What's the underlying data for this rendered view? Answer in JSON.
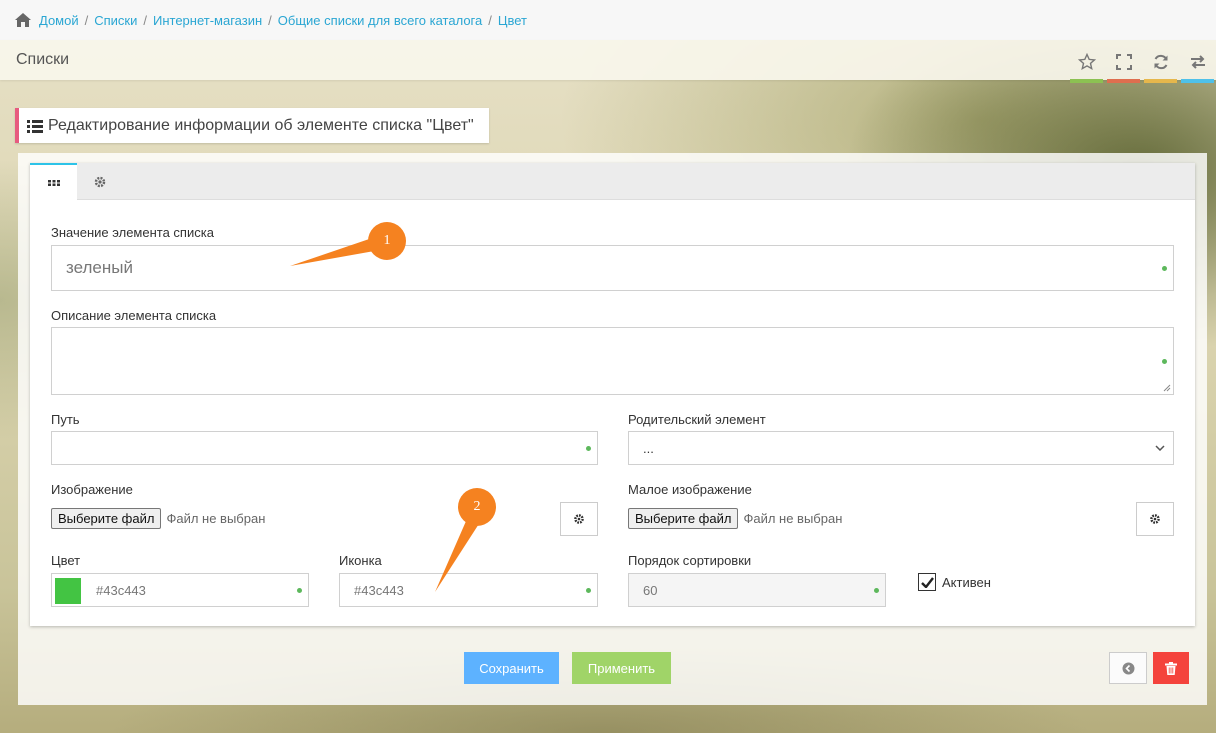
{
  "breadcrumbs": [
    "Домой",
    "Списки",
    "Интернет-магазин",
    "Общие списки для всего каталога",
    "Цвет"
  ],
  "page": {
    "title": "Списки"
  },
  "header_buttons": [
    "star-icon",
    "expand-icon",
    "refresh-icon",
    "exchange-icon"
  ],
  "section": {
    "caption": "Редактирование информации об элементе списка \"Цвет\""
  },
  "tabs": [
    "main-tab-icon",
    "settings-tab-icon"
  ],
  "form": {
    "value_label": "Значение элемента списка",
    "value": "зеленый",
    "description_label": "Описание элемента списка",
    "path_label": "Путь",
    "parent_label": "Родительский элемент",
    "parent_value": "...",
    "image_label": "Изображение",
    "small_image_label": "Малое изображение",
    "choose_file": "Выберите файл",
    "no_file": "Файл не выбран",
    "color_label": "Цвет",
    "color_value": "#43c443",
    "icon_label": "Иконка",
    "icon_value": "#43c443",
    "sort_label": "Порядок сортировки",
    "sort_value": "60",
    "active_label": "Активен",
    "active_checked": true
  },
  "buttons": {
    "save": "Сохранить",
    "apply": "Применить"
  },
  "annotations": [
    "1",
    "2"
  ],
  "colors": {
    "swatch": "#43c443",
    "accent_badge": "#f58220",
    "save": "#5db2ff",
    "apply": "#a0d468",
    "delete": "#f4433c"
  }
}
